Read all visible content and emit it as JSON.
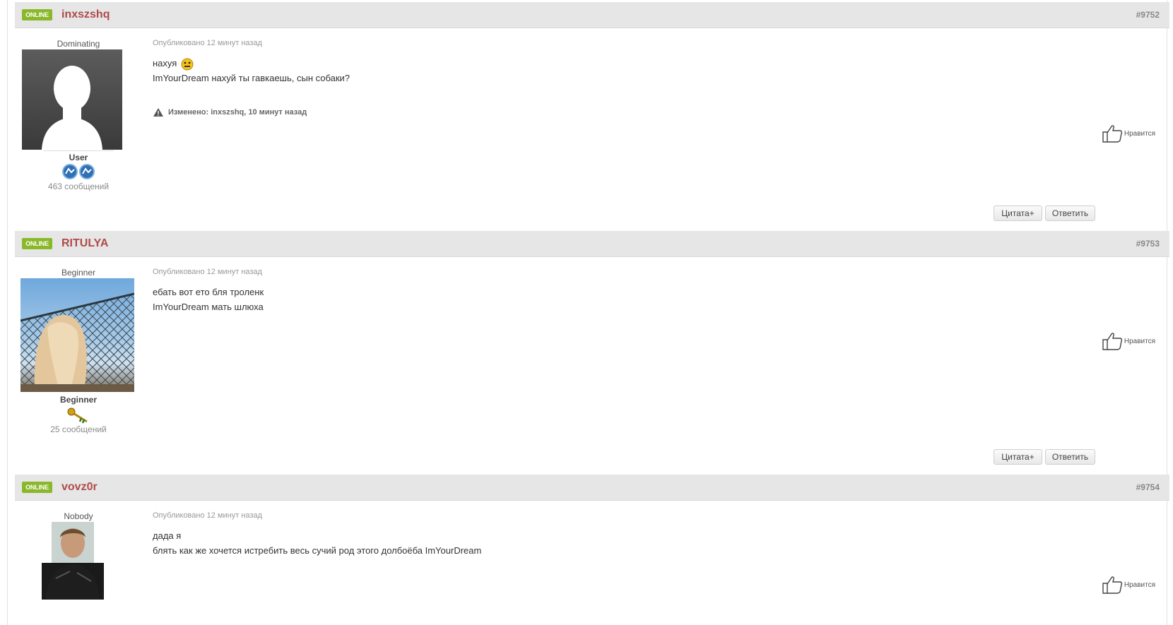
{
  "posts": [
    {
      "badge": "ONLINE",
      "username": "inxszshq",
      "number": "#9752",
      "user_title": "Dominating",
      "rank": "User",
      "message_count": "463 сообщений",
      "date": "Опубликовано 12 минут назад",
      "lines": [
        "нахуя",
        "ImYourDream нахуй ты гавкаешь, сын собаки?"
      ],
      "edited": "Изменено: inxszshq, 10 минут назад",
      "like_label": "Нравится",
      "quote_label": "Цитата+",
      "reply_label": "Ответить"
    },
    {
      "badge": "ONLINE",
      "username": "RITULYA",
      "number": "#9753",
      "user_title": "Beginner",
      "rank": "Beginner",
      "message_count": "25 сообщений",
      "date": "Опубликовано 12 минут назад",
      "lines": [
        "ебать вот ето бля троленк",
        "ImYourDream мать шлюха"
      ],
      "like_label": "Нравится",
      "quote_label": "Цитата+",
      "reply_label": "Ответить"
    },
    {
      "badge": "ONLINE",
      "username": "vovz0r",
      "number": "#9754",
      "user_title": "Nobody",
      "date": "Опубликовано 12 минут назад",
      "lines": [
        "дада я",
        "блять как же хочется истребить весь сучий род этого долбоёба ImYourDream"
      ],
      "like_label": "Нравится"
    }
  ],
  "colors": {
    "header_bg": "#e6e6e6",
    "online_badge": "#8ab82a",
    "username": "#b04a4a"
  }
}
